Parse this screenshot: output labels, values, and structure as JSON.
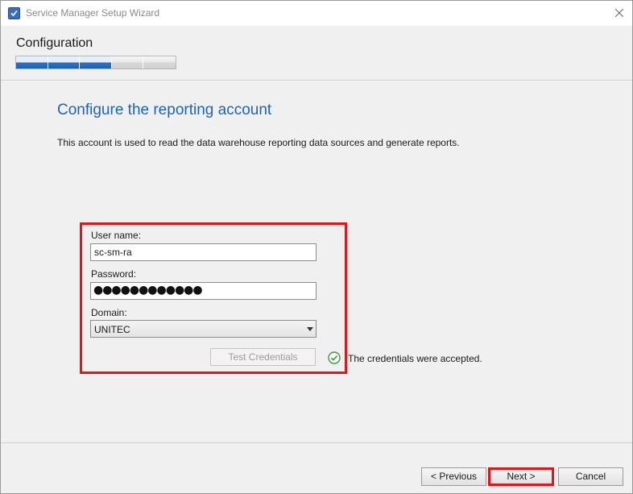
{
  "window": {
    "title": "Service Manager Setup Wizard"
  },
  "header": {
    "stage_title": "Configuration",
    "progress": {
      "total_steps": 5,
      "completed_steps": 3
    }
  },
  "page": {
    "heading": "Configure the reporting account",
    "description": "This account is used to read the data warehouse reporting data sources and generate reports."
  },
  "form": {
    "username_label": "User name:",
    "username_value": "sc-sm-ra",
    "password_label": "Password:",
    "password_masked": "●●●●●●●●●●●●",
    "domain_label": "Domain:",
    "domain_value": "UNITEC",
    "test_button": "Test Credentials"
  },
  "status": {
    "message": "The credentials were accepted.",
    "icon": "check-circle-icon",
    "color": "#3a9a3a"
  },
  "footer": {
    "previous_label": "< Previous",
    "next_label": "Next >",
    "cancel_label": "Cancel"
  },
  "colors": {
    "heading": "#1f63b4",
    "highlight": "#e0161b",
    "progress_done": "#2f73c6"
  }
}
